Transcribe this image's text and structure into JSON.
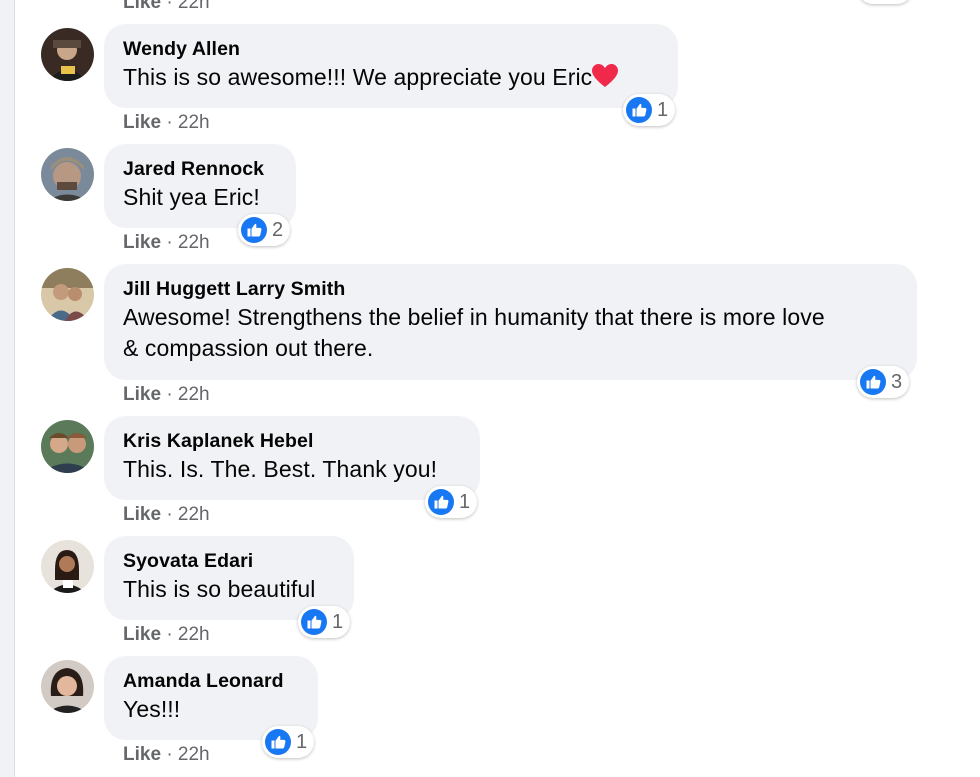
{
  "top_partial": {
    "like": "Like",
    "sep": "·",
    "time": "22h"
  },
  "comments": [
    {
      "author": "Wendy Allen",
      "text": "This is so awesome!!! We appreciate you Eric",
      "has_heart": true,
      "like": "Like",
      "sep": "·",
      "time": "22h",
      "reactions": "1"
    },
    {
      "author": "Jared Rennock",
      "text": "Shit yea Eric!",
      "like": "Like",
      "sep": "·",
      "time": "22h",
      "reactions": "2"
    },
    {
      "author": "Jill Huggett Larry Smith",
      "text_line1": "Awesome! Strengthens the belief in humanity that there is more love",
      "text_line2": "& compassion out there.",
      "like": "Like",
      "sep": "·",
      "time": "22h",
      "reactions": "3"
    },
    {
      "author": "Kris Kaplanek Hebel",
      "text": "This. Is. The. Best. Thank you!",
      "like": "Like",
      "sep": "·",
      "time": "22h",
      "reactions": "1"
    },
    {
      "author": "Syovata Edari",
      "text": "This is so beautiful",
      "like": "Like",
      "sep": "·",
      "time": "22h",
      "reactions": "1"
    },
    {
      "author": "Amanda Leonard",
      "text": "Yes!!!",
      "like": "Like",
      "sep": "·",
      "time": "22h",
      "reactions": "1"
    }
  ],
  "colors": {
    "bubble": "#f0f2f5",
    "like_blue": "#1877f2",
    "meta_gray": "#65676b",
    "heart_red": "#f02849"
  },
  "icons": {
    "reaction": "thumbs-up-icon",
    "heart": "heart-emoji-icon"
  }
}
